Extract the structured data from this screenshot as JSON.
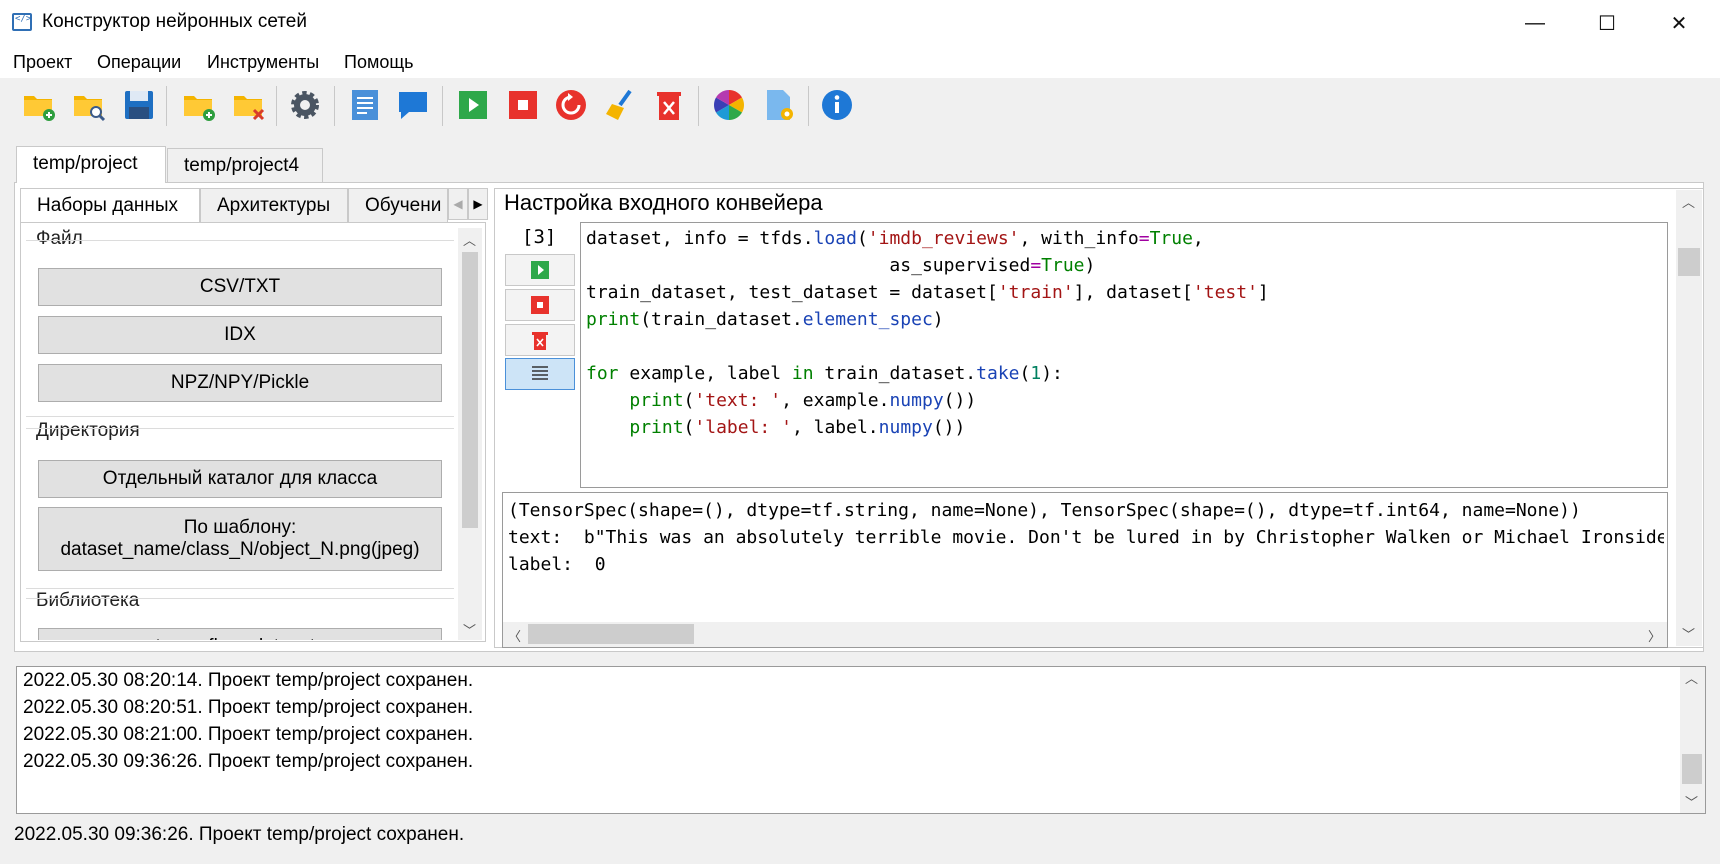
{
  "window": {
    "title": "Конструктор нейронных сетей",
    "min_glyph": "—",
    "max_glyph": "☐",
    "close_glyph": "✕"
  },
  "menu": [
    "Проект",
    "Операции",
    "Инструменты",
    "Помощь"
  ],
  "toolbar_icons": [
    "new-project-icon",
    "open-project-icon",
    "save-icon",
    "add-folder-icon",
    "remove-folder-icon",
    "settings-icon",
    "document-icon",
    "comment-icon",
    "run-icon",
    "stop-icon",
    "restart-icon",
    "clear-icon",
    "delete-icon",
    "color-wheel-icon",
    "file-settings-icon",
    "info-icon"
  ],
  "project_tabs": [
    "temp/project",
    "temp/project4"
  ],
  "sub_tabs": [
    "Наборы данных",
    "Архитектуры",
    "Обучени"
  ],
  "groups": {
    "file": {
      "label": "Файл",
      "buttons": [
        "CSV/TXT",
        "IDX",
        "NPZ/NPY/Pickle"
      ]
    },
    "directory": {
      "label": "Директория",
      "button1": "Отдельный каталог для класса",
      "button2_line1": "По шаблону:",
      "button2_line2": "dataset_name/class_N/object_N.png(jpeg)"
    },
    "library": {
      "label": "Библиотека",
      "button_partial": "tensorflow_datasets"
    }
  },
  "section_title": "Настройка входного конвейера",
  "cell_number": "[3]",
  "code_lines": [
    [
      {
        "t": "dataset, info = tfds.",
        "c": ""
      },
      {
        "t": "load",
        "c": "fn"
      },
      {
        "t": "(",
        "c": ""
      },
      {
        "t": "'imdb_reviews'",
        "c": "str"
      },
      {
        "t": ", with_info",
        "c": ""
      },
      {
        "t": "=",
        "c": "eq"
      },
      {
        "t": "True",
        "c": "bool"
      },
      {
        "t": ",",
        "c": ""
      }
    ],
    [
      {
        "t": "                            as_supervised",
        "c": ""
      },
      {
        "t": "=",
        "c": "eq"
      },
      {
        "t": "True",
        "c": "bool"
      },
      {
        "t": ")",
        "c": ""
      }
    ],
    [
      {
        "t": "train_dataset, test_dataset = dataset[",
        "c": ""
      },
      {
        "t": "'train'",
        "c": "str"
      },
      {
        "t": "], dataset[",
        "c": ""
      },
      {
        "t": "'test'",
        "c": "str"
      },
      {
        "t": "]",
        "c": ""
      }
    ],
    [
      {
        "t": "print",
        "c": "kw"
      },
      {
        "t": "(train_dataset.",
        "c": ""
      },
      {
        "t": "element_spec",
        "c": "fn"
      },
      {
        "t": ")",
        "c": ""
      }
    ],
    [
      {
        "t": "",
        "c": ""
      }
    ],
    [
      {
        "t": "for",
        "c": "kw"
      },
      {
        "t": " example, label ",
        "c": ""
      },
      {
        "t": "in",
        "c": "kw"
      },
      {
        "t": " train_dataset.",
        "c": ""
      },
      {
        "t": "take",
        "c": "fn"
      },
      {
        "t": "(",
        "c": ""
      },
      {
        "t": "1",
        "c": "num"
      },
      {
        "t": "):",
        "c": ""
      }
    ],
    [
      {
        "t": "    ",
        "c": ""
      },
      {
        "t": "print",
        "c": "kw"
      },
      {
        "t": "(",
        "c": ""
      },
      {
        "t": "'text: '",
        "c": "str"
      },
      {
        "t": ", example.",
        "c": ""
      },
      {
        "t": "numpy",
        "c": "fn"
      },
      {
        "t": "())",
        "c": ""
      }
    ],
    [
      {
        "t": "    ",
        "c": ""
      },
      {
        "t": "print",
        "c": "kw"
      },
      {
        "t": "(",
        "c": ""
      },
      {
        "t": "'label: '",
        "c": "str"
      },
      {
        "t": ", label.",
        "c": ""
      },
      {
        "t": "numpy",
        "c": "fn"
      },
      {
        "t": "())",
        "c": ""
      }
    ]
  ],
  "output_lines": [
    "(TensorSpec(shape=(), dtype=tf.string, name=None), TensorSpec(shape=(), dtype=tf.int64, name=None))",
    "text:  b\"This was an absolutely terrible movie. Don't be lured in by Christopher Walken or Michael Ironside.",
    "label:  0"
  ],
  "log_lines": [
    "2022.05.30 08:20:14. Проект temp/project сохранен.",
    "2022.05.30 08:20:51. Проект temp/project сохранен.",
    "2022.05.30 08:21:00. Проект temp/project сохранен.",
    "2022.05.30 09:36:26. Проект temp/project сохранен."
  ],
  "status": "2022.05.30 09:36:26. Проект temp/project сохранен."
}
